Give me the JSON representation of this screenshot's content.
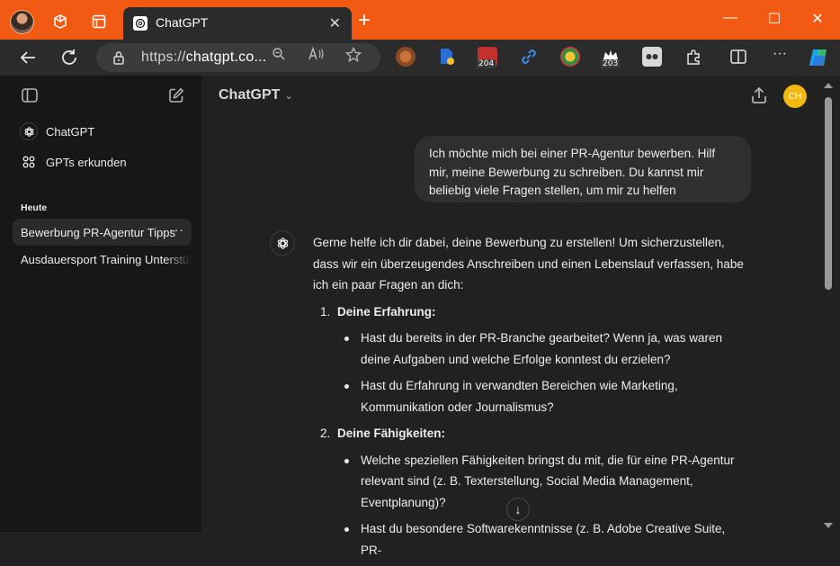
{
  "browser": {
    "tab_title": "ChatGPT",
    "tab_close": "✕",
    "new_tab": "+",
    "url_prefix": "https://",
    "url_host": "chatgpt.co...",
    "ext_badges": [
      "204",
      "203"
    ],
    "window_controls": {
      "minimize": "—",
      "maximize": "☐",
      "close": "✕"
    },
    "accent_color": "#f25a14"
  },
  "sidebar": {
    "items": [
      {
        "label": "ChatGPT",
        "icon": "openai-logo-icon"
      },
      {
        "label": "GPTs erkunden",
        "icon": "grid-icon"
      }
    ],
    "section_heading": "Heute",
    "chats": [
      {
        "title": "Bewerbung PR-Agentur Tipps",
        "active": true,
        "menu": "···"
      },
      {
        "title": "Ausdauersport Training Unterstützung",
        "active": false
      }
    ]
  },
  "header": {
    "model": "ChatGPT",
    "model_chevron": "⌄",
    "user_initials": "CH",
    "user_avatar_color": "#f3b90e"
  },
  "conversation": {
    "user_message": "Ich möchte mich bei einer PR-Agentur bewerben. Hilf mir, meine Bewerbung zu schreiben. Du kannst mir beliebig viele Fragen stellen, um mir zu helfen",
    "assistant_intro": "Gerne helfe ich dir dabei, deine Bewerbung zu erstellen! Um sicherzustellen, dass wir ein überzeugendes Anschreiben und einen Lebenslauf verfassen, habe ich ein paar Fragen an dich:",
    "sections": [
      {
        "number": "1.",
        "heading": "Deine Erfahrung:",
        "bullets": [
          "Hast du bereits in der PR-Branche gearbeitet? Wenn ja, was waren deine Aufgaben und welche Erfolge konntest du erzielen?",
          "Hast du Erfahrung in verwandten Bereichen wie Marketing, Kommunikation oder Journalismus?"
        ]
      },
      {
        "number": "2.",
        "heading": "Deine Fähigkeiten:",
        "bullets": [
          "Welche speziellen Fähigkeiten bringst du mit, die für eine PR-Agentur relevant sind (z. B. Texterstellung, Social Media Management, Eventplanung)?",
          "Hast du besondere Softwarekenntnisse (z. B. Adobe Creative Suite, PR-"
        ]
      }
    ],
    "scroll_down": "↓"
  }
}
